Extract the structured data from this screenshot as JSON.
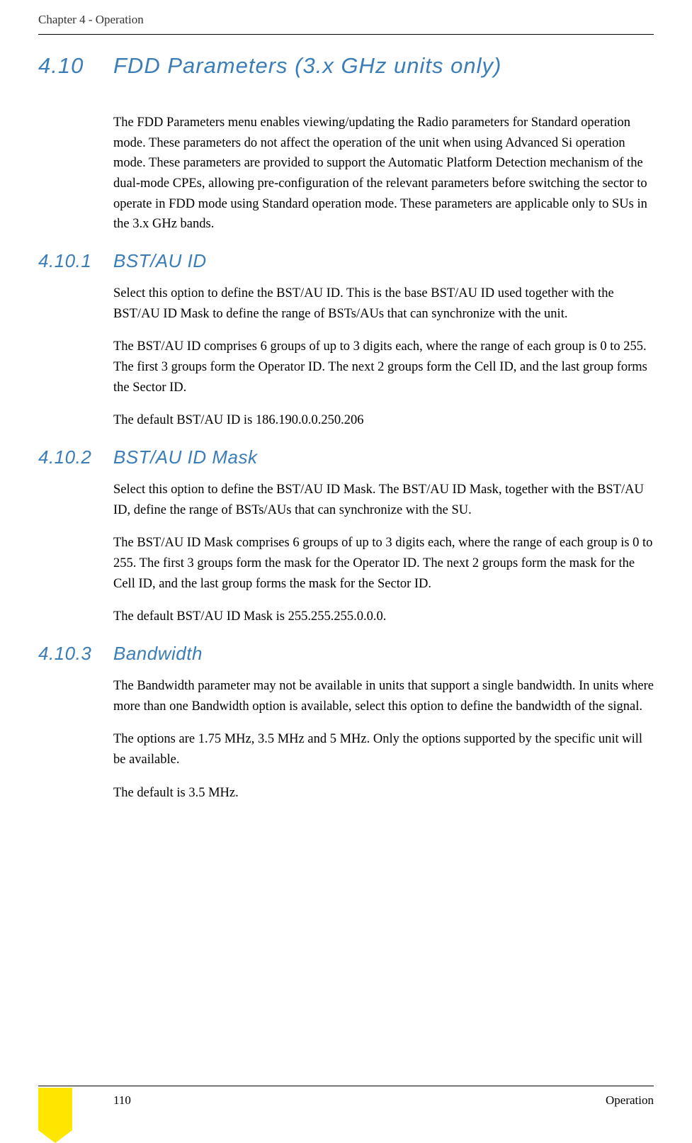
{
  "header": {
    "chapter": "Chapter 4 - Operation"
  },
  "main_section": {
    "number": "4.10",
    "title": "FDD Parameters (3.x GHz units only)",
    "intro": "The FDD Parameters menu enables viewing/updating the Radio parameters for Standard operation mode. These parameters do not affect the operation of the unit when using Advanced Si operation mode. These parameters are provided to support the Automatic Platform Detection mechanism of the dual-mode CPEs, allowing pre-configuration of the relevant parameters before switching the sector to operate in FDD mode using Standard operation mode. These parameters are applicable only to SUs in the 3.x GHz bands."
  },
  "sections": [
    {
      "number": "4.10.1",
      "title": "BST/AU ID",
      "paragraphs": [
        "Select this option to define the BST/AU ID. This is the base BST/AU ID used together with the BST/AU ID Mask to define the range of BSTs/AUs that can synchronize with the unit.",
        "The BST/AU ID comprises 6 groups of up to 3 digits each, where the range of each group is 0 to 255. The first 3 groups form the Operator ID. The next 2 groups form the Cell ID, and the last group forms the Sector ID.",
        "The default BST/AU ID is 186.190.0.0.250.206"
      ]
    },
    {
      "number": "4.10.2",
      "title": "BST/AU ID Mask",
      "paragraphs": [
        "Select this option to define the BST/AU ID Mask. The BST/AU ID Mask, together with the BST/AU ID, define the range of BSTs/AUs that can synchronize with the SU.",
        "The BST/AU ID Mask comprises 6 groups of up to 3 digits each, where the range of each group is 0 to 255. The first 3 groups form the mask for the Operator ID. The next 2 groups form the mask for the Cell ID, and the last group forms the mask for the Sector ID.",
        "The default BST/AU ID Mask is 255.255.255.0.0.0."
      ]
    },
    {
      "number": "4.10.3",
      "title": "Bandwidth",
      "paragraphs": [
        "The Bandwidth parameter may not be available in units that support a single bandwidth. In units where more than one Bandwidth option is available, select this option to define the bandwidth of the signal.",
        "The options are 1.75 MHz, 3.5 MHz and 5 MHz. Only the options supported by the specific unit will be available.",
        "The default is 3.5 MHz."
      ]
    }
  ],
  "footer": {
    "page_number": "110",
    "label": "Operation"
  }
}
